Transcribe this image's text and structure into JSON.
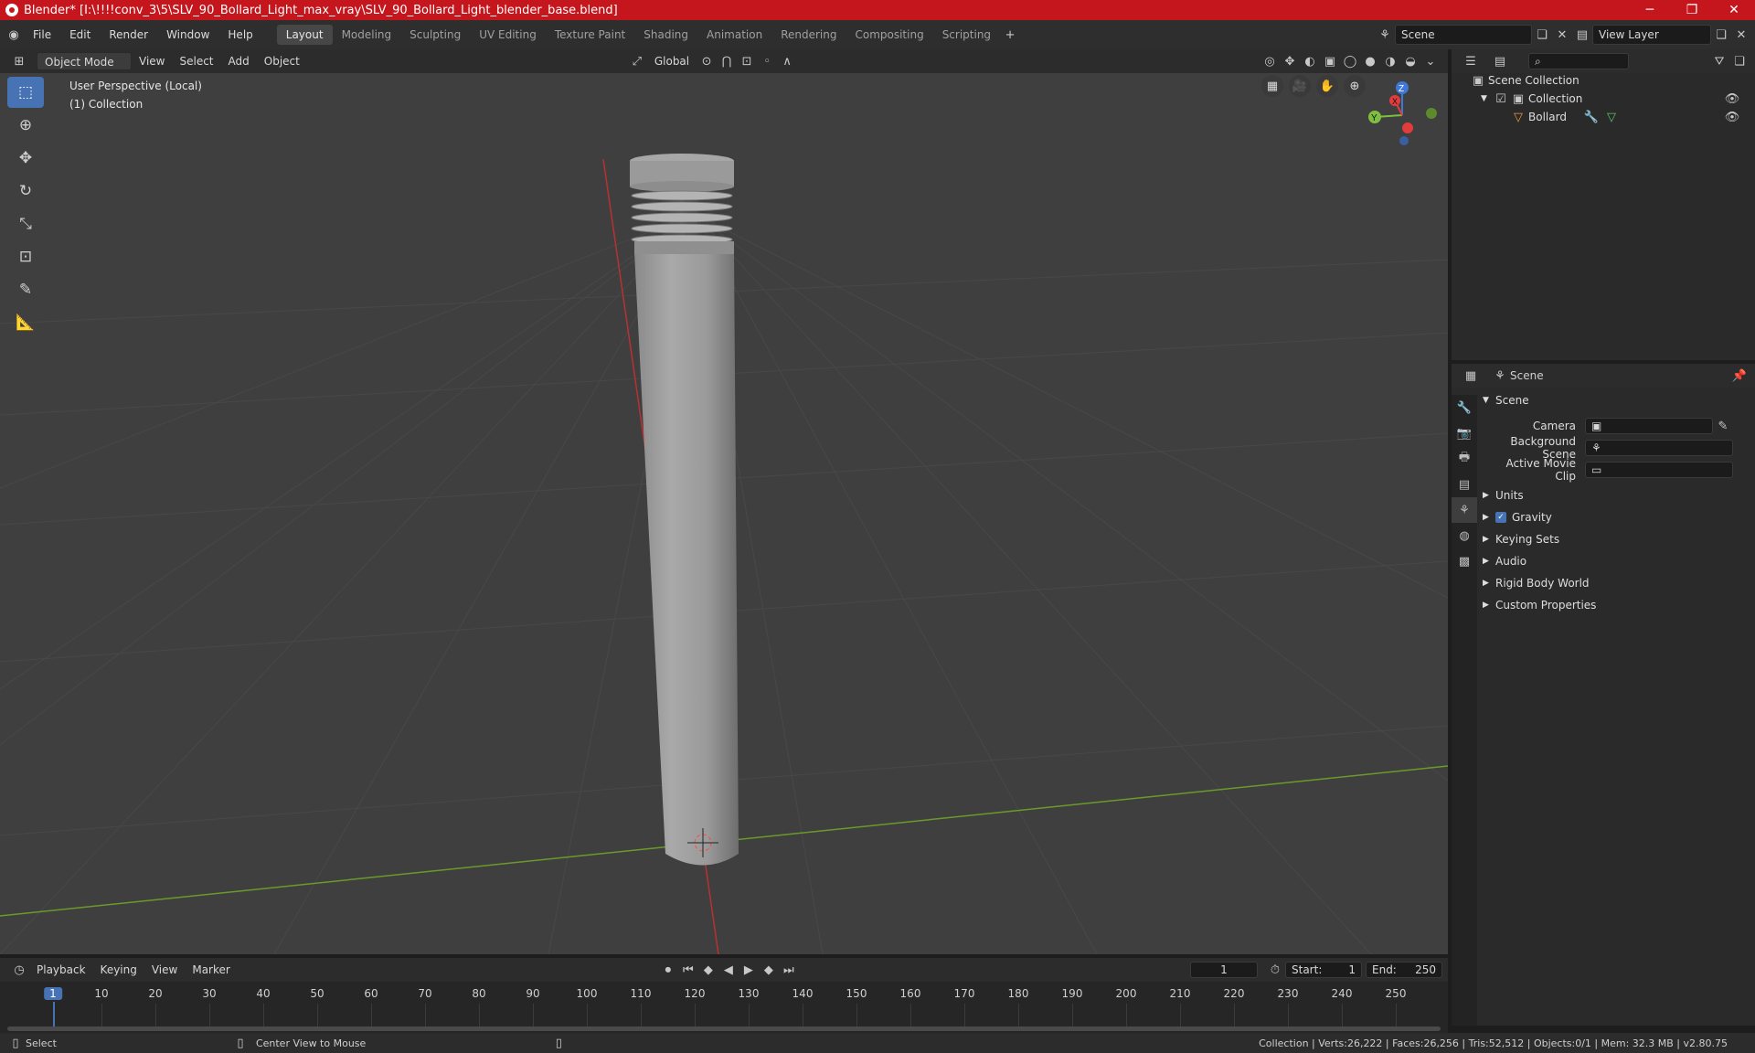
{
  "window": {
    "title": "Blender* [I:\\!!!!conv_3\\5\\SLV_90_Bollard_Light_max_vray\\SLV_90_Bollard_Light_blender_base.blend]",
    "controls": [
      "─",
      "❐",
      "✕"
    ]
  },
  "menu": [
    "File",
    "Edit",
    "Render",
    "Window",
    "Help"
  ],
  "workspaces": [
    "Layout",
    "Modeling",
    "Sculpting",
    "UV Editing",
    "Texture Paint",
    "Shading",
    "Animation",
    "Rendering",
    "Compositing",
    "Scripting"
  ],
  "active_workspace": "Layout",
  "scene_field": "Scene",
  "view_layer_field": "View Layer",
  "viewport_header": {
    "mode": "Object Mode",
    "menus": [
      "View",
      "Select",
      "Add",
      "Object"
    ],
    "orientation": "Global"
  },
  "viewport": {
    "perspective": "User Perspective (Local)",
    "collection": "(1) Collection",
    "gizmo": {
      "x": "X",
      "y": "Y",
      "z": "Z"
    }
  },
  "outliner": {
    "root": "Scene Collection",
    "collection": "Collection",
    "object": "Bollard"
  },
  "properties": {
    "header": "Scene",
    "section": "Scene",
    "fields": [
      {
        "label": "Camera",
        "value": ""
      },
      {
        "label": "Background Scene",
        "value": ""
      },
      {
        "label": "Active Movie Clip",
        "value": ""
      }
    ],
    "panels": [
      "Units",
      "Gravity",
      "Keying Sets",
      "Audio",
      "Rigid Body World",
      "Custom Properties"
    ],
    "gravity_checked": true
  },
  "timeline": {
    "menus": [
      "Playback",
      "Keying",
      "View",
      "Marker"
    ],
    "current_frame": "1",
    "start_label": "Start:",
    "start": "1",
    "end_label": "End:",
    "end": "250",
    "ticks": [
      "1",
      "10",
      "20",
      "30",
      "40",
      "50",
      "60",
      "70",
      "80",
      "90",
      "100",
      "110",
      "120",
      "130",
      "140",
      "150",
      "160",
      "170",
      "180",
      "190",
      "200",
      "210",
      "220",
      "230",
      "240",
      "250"
    ]
  },
  "statusbar": {
    "select": "Select",
    "center": "Center View to Mouse",
    "stats": "Collection | Verts:26,222 | Faces:26,256 | Tris:52,512 | Objects:0/1 | Mem: 32.3 MB | v2.80.75"
  },
  "colors": {
    "titlebar": "#c4161c",
    "accent": "#4772b3",
    "x_axis": "#e23c3c",
    "y_axis": "#7fbf3f",
    "z_axis": "#3f78d8"
  }
}
